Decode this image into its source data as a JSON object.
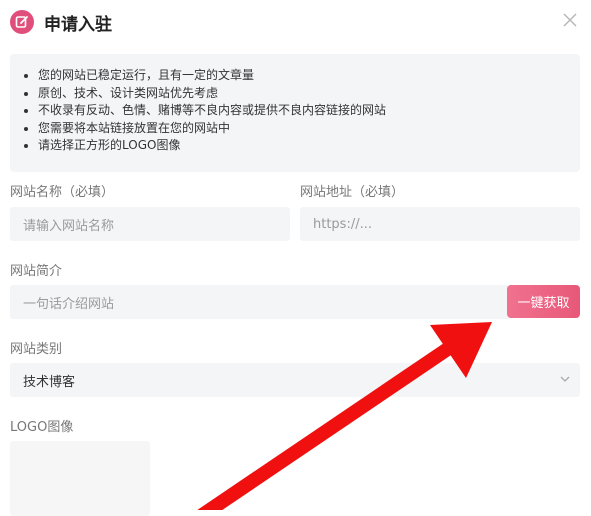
{
  "dialog": {
    "title": "申请入驻",
    "icon": "edit-icon"
  },
  "notice": [
    "您的网站已稳定运行，且有一定的文章量",
    "原创、技术、设计类网站优先考虑",
    "不收录有反动、色情、赌博等不良内容或提供不良内容链接的网站",
    "您需要将本站链接放置在您的网站中",
    "请选择正方形的LOGO图像"
  ],
  "form": {
    "site_name": {
      "label": "网站名称（必填）",
      "placeholder": "请输入网站名称"
    },
    "site_url": {
      "label": "网站地址（必填）",
      "placeholder": "https://..."
    },
    "site_desc": {
      "label": "网站简介",
      "placeholder": "一句话介绍网站",
      "button": "一键获取"
    },
    "category": {
      "label": "网站类别",
      "value": "技术博客"
    },
    "logo": {
      "label": "LOGO图像"
    }
  },
  "colors": {
    "accent": "#e85878",
    "icon_bg": "#e04e7c",
    "arrow": "#f01010",
    "field_bg": "#f4f5f7"
  }
}
